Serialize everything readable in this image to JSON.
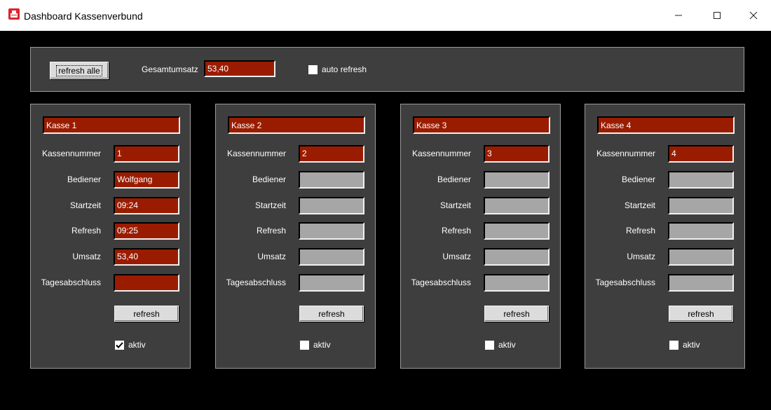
{
  "window": {
    "title": "Dashboard Kassenverbund",
    "icon": "app-icon"
  },
  "toolbar": {
    "refresh_all_label": "refresh alle",
    "total_label": "Gesamtumsatz",
    "total_value": "53,40",
    "auto_refresh_label": "auto refresh",
    "auto_refresh_checked": false
  },
  "labels": {
    "kassennummer": "Kassennummer",
    "bediener": "Bediener",
    "startzeit": "Startzeit",
    "refresh": "Refresh",
    "umsatz": "Umsatz",
    "tagesabschluss": "Tagesabschluss",
    "refresh_button": "refresh",
    "aktiv": "aktiv"
  },
  "colors": {
    "active_field": "#9a1c00",
    "inactive_field": "#a6a6a6",
    "panel_bg": "#3e3e3e"
  },
  "kassen": [
    {
      "name": "Kasse 1",
      "nummer": "1",
      "bediener": "Wolfgang",
      "startzeit": "09:24",
      "refresh": "09:25",
      "umsatz": "53,40",
      "tagesabschluss": "",
      "aktiv": true
    },
    {
      "name": "Kasse 2",
      "nummer": "2",
      "bediener": "",
      "startzeit": "",
      "refresh": "",
      "umsatz": "",
      "tagesabschluss": "",
      "aktiv": false
    },
    {
      "name": "Kasse 3",
      "nummer": "3",
      "bediener": "",
      "startzeit": "",
      "refresh": "",
      "umsatz": "",
      "tagesabschluss": "",
      "aktiv": false
    },
    {
      "name": "Kasse 4",
      "nummer": "4",
      "bediener": "",
      "startzeit": "",
      "refresh": "",
      "umsatz": "",
      "tagesabschluss": "",
      "aktiv": false
    }
  ]
}
